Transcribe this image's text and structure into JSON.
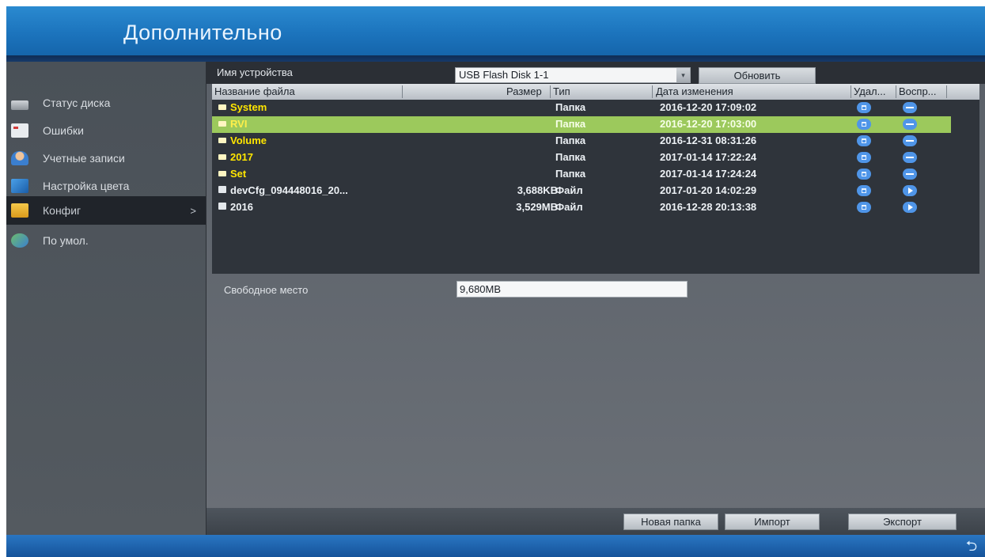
{
  "header": {
    "title": "Дополнительно"
  },
  "sidebar": {
    "items": [
      {
        "label": "Статус диска"
      },
      {
        "label": "Ошибки"
      },
      {
        "label": "Учетные записи"
      },
      {
        "label": "Настройка цвета"
      },
      {
        "label": "Конфиг",
        "arrow": ">"
      },
      {
        "label": "По умол."
      }
    ]
  },
  "device": {
    "label": "Имя устройства",
    "selected": "USB Flash Disk 1-1",
    "refresh_label": "Обновить"
  },
  "table": {
    "headers": {
      "name": "Название файла",
      "size": "Размер",
      "type": "Тип",
      "date": "Дата изменения",
      "delete": "Удал...",
      "play": "Воспр..."
    },
    "rows": [
      {
        "name": "System",
        "size": "",
        "type": "Папка",
        "date": "2016-12-20 17:09:02"
      },
      {
        "name": "RVI",
        "size": "",
        "type": "Папка",
        "date": "2016-12-20 17:03:00"
      },
      {
        "name": "Volume",
        "size": "",
        "type": "Папка",
        "date": "2016-12-31 08:31:26"
      },
      {
        "name": "2017",
        "size": "",
        "type": "Папка",
        "date": "2017-01-14 17:22:24"
      },
      {
        "name": "Set",
        "size": "",
        "type": "Папка",
        "date": "2017-01-14 17:24:24"
      },
      {
        "name": "devCfg_094448016_20...",
        "size": "3,688KB",
        "type": "Файл",
        "date": "2017-01-20 14:02:29"
      },
      {
        "name": "2016",
        "size": "3,529MB",
        "type": "Файл",
        "date": "2016-12-28 20:13:38"
      }
    ]
  },
  "free_space": {
    "label": "Свободное место",
    "value": "9,680MB"
  },
  "actions": {
    "new_folder": "Новая папка",
    "import": "Импорт",
    "export": "Экспорт"
  },
  "footer": {
    "back_glyph": "⮌"
  },
  "colors": {
    "header_blue": "#1c74bd",
    "selected_row": "#9cc95c",
    "folder_text": "#ffe600",
    "action_icon": "#4f95e8"
  }
}
